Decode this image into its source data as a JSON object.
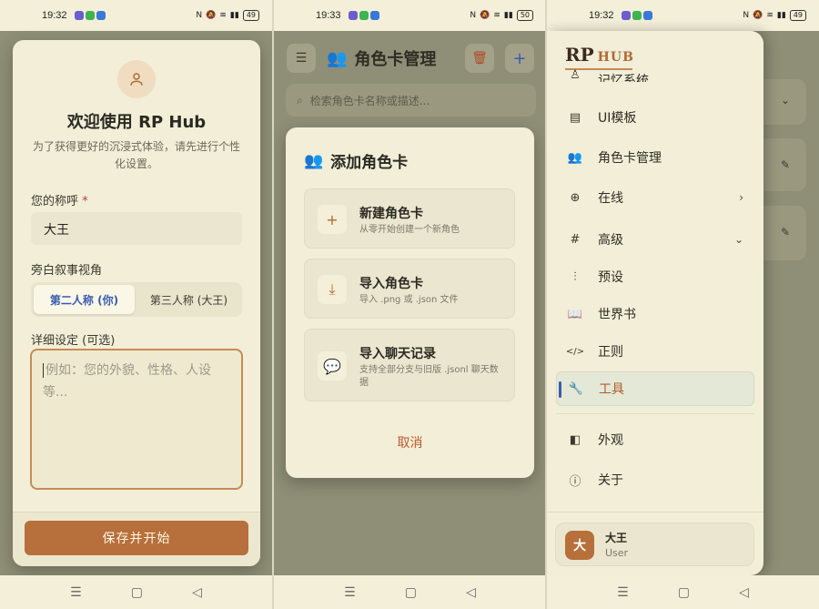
{
  "phone1": {
    "status": {
      "time": "19:32",
      "battery": "49"
    },
    "title": "欢迎使用 RP Hub",
    "subtitle": "为了获得更好的沉浸式体验，请先进行个性化设置。",
    "name_label": "您的称呼",
    "required_mark": "*",
    "name_value": "大王",
    "pov_label": "旁白叙事视角",
    "pov_options": [
      "第二人称 (你)",
      "第三人称 (大王)"
    ],
    "pov_selected": 0,
    "detail_label": "详细设定 (可选)",
    "detail_placeholder": "例如：您的外貌、性格、人设等...",
    "save_button": "保存并开始",
    "icons": {
      "avatar": "user-icon"
    }
  },
  "phone2": {
    "status": {
      "time": "19:33",
      "battery": "50"
    },
    "header_title": "角色卡管理",
    "search_placeholder": "检索角色卡名称或描述...",
    "modal": {
      "title": "添加角色卡",
      "options": [
        {
          "title": "新建角色卡",
          "desc": "从零开始创建一个新角色",
          "icon": "+"
        },
        {
          "title": "导入角色卡",
          "desc": "导入 .png 或 .json 文件",
          "icon": "⤓"
        },
        {
          "title": "导入聊天记录",
          "desc": "支持全部分支与旧版 .jsonl 聊天数据",
          "icon": "💬"
        }
      ],
      "cancel": "取消"
    },
    "icons": {
      "menu": "menu-icon",
      "trash": "trash-icon",
      "add": "plus-icon"
    }
  },
  "phone3": {
    "status": {
      "time": "19:32",
      "battery": "49"
    },
    "logo_rp": "RP",
    "logo_hub": "HUB",
    "menu": [
      {
        "label": "记忆系统",
        "icon": "♙",
        "chevron": ""
      },
      {
        "label": "UI模板",
        "icon": "▤",
        "chevron": ""
      },
      {
        "label": "角色卡管理",
        "icon": "👥",
        "chevron": ""
      },
      {
        "label": "在线",
        "icon": "⊕",
        "chevron": "›"
      },
      {
        "label": "高级",
        "icon": "#",
        "chevron": "⌄"
      },
      {
        "label": "预设",
        "icon": "⫶",
        "chevron": ""
      },
      {
        "label": "世界书",
        "icon": "📖",
        "chevron": ""
      },
      {
        "label": "正则",
        "icon": "</>",
        "chevron": ""
      },
      {
        "label": "工具",
        "icon": "🔧",
        "chevron": ""
      },
      {
        "label": "外观",
        "icon": "◧",
        "chevron": ""
      },
      {
        "label": "关于",
        "icon": "ⓘ",
        "chevron": ""
      }
    ],
    "active_index": 8,
    "user": {
      "avatar": "大",
      "name": "大王",
      "role": "User"
    }
  },
  "colors": {
    "accent": "#b7703b",
    "bg": "#f2eed7",
    "link": "#3a5bb0",
    "danger": "#c0582e"
  }
}
